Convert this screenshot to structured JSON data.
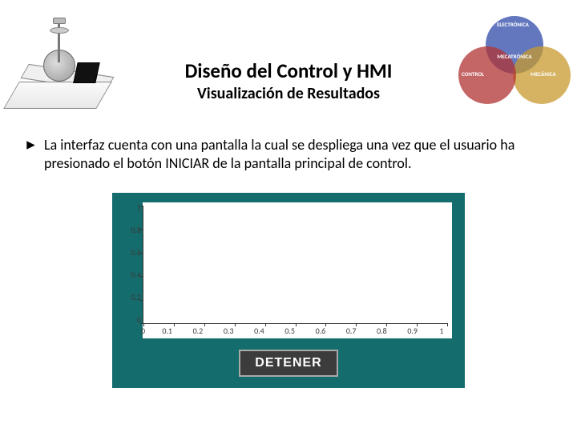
{
  "header": {
    "title": "Diseño del Control y HMI",
    "subtitle": "Visualización de Resultados"
  },
  "bullet": {
    "text": "La interfaz cuenta con una pantalla la cual se despliega una vez que el usuario ha presionado el botón INICIAR de la pantalla principal de control."
  },
  "chart_data": {
    "type": "line",
    "title": "",
    "xlabel": "",
    "ylabel": "",
    "xlim": [
      0,
      1
    ],
    "ylim": [
      0,
      1
    ],
    "x_ticks": [
      "0",
      "0.1",
      "0.2",
      "0.3",
      "0.4",
      "0.5",
      "0.6",
      "0.7",
      "0.8",
      "0.9",
      "1"
    ],
    "y_ticks": [
      "1",
      "0.8",
      "0.6",
      "0.4",
      "0.2",
      "0"
    ],
    "series": []
  },
  "hmi": {
    "stop_label": "DETENER"
  },
  "venn": {
    "center": "MECATRÓNICA",
    "top": "ELECTRÓNICA",
    "left": "CONTROL",
    "right": "MECÁNICA"
  }
}
